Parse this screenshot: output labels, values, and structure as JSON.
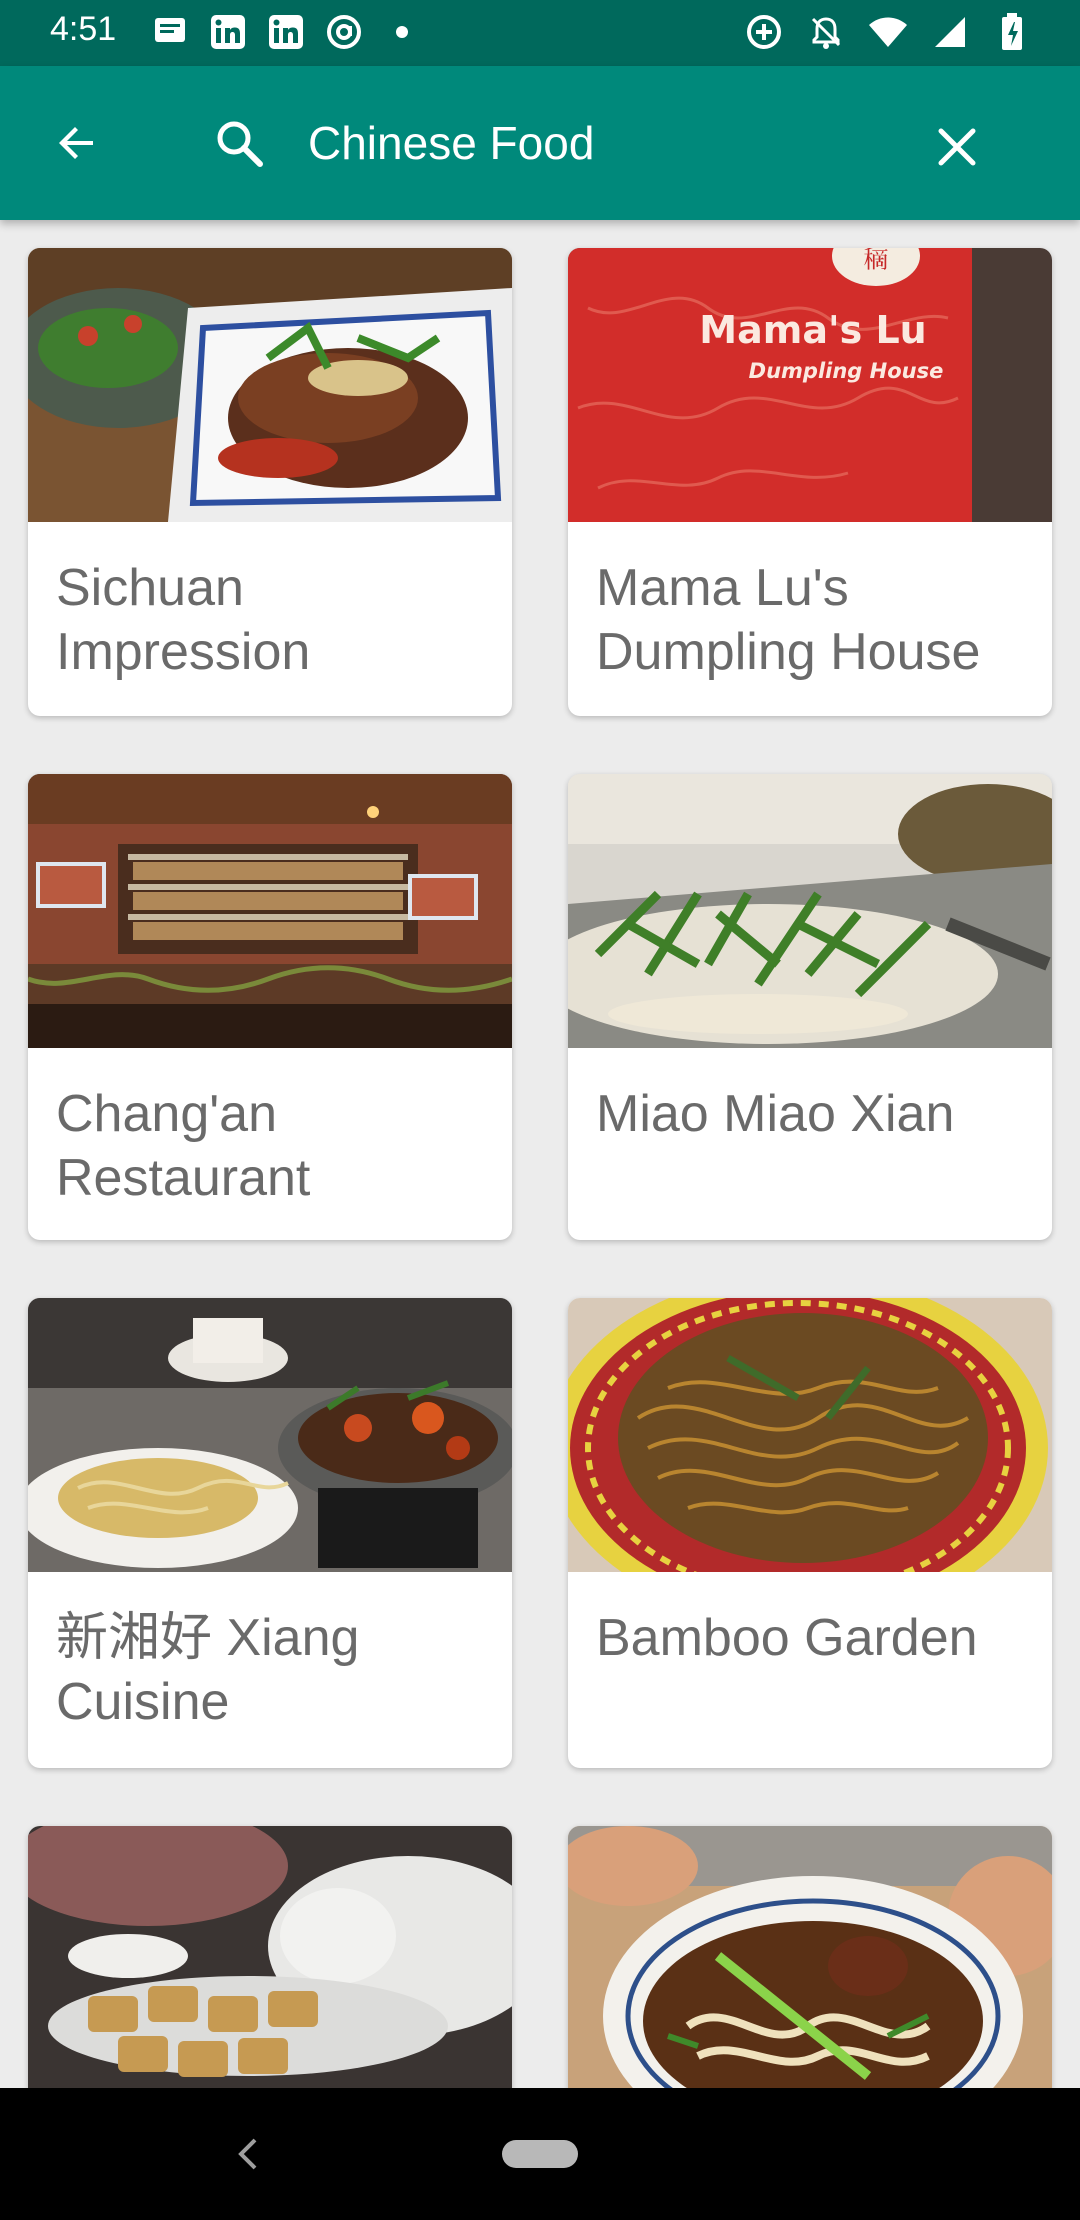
{
  "status_bar": {
    "time": "4:51",
    "left_icons": [
      "messages-icon",
      "linkedin-icon",
      "linkedin-icon",
      "at-sign-icon",
      "dot-icon"
    ],
    "right_icons": [
      "data-saver-icon",
      "notifications-off-icon",
      "wifi-icon",
      "signal-icon",
      "battery-icon"
    ]
  },
  "app_bar": {
    "search_value": "Chinese Food",
    "colors": {
      "status": "#00695c",
      "toolbar": "#00897b"
    }
  },
  "results": [
    {
      "title": "Sichuan Impression",
      "image": "sliced-beef-dish-photo"
    },
    {
      "title": "Mama Lu's Dumpling House",
      "image": "red-menu-cover-photo",
      "image_text": {
        "line1": "Mama's Lu",
        "line2": "Dumpling House"
      }
    },
    {
      "title": "Chang'an Restaurant",
      "image": "restaurant-bar-interior-photo"
    },
    {
      "title": "Miao Miao Xian",
      "image": "noodle-salad-photo"
    },
    {
      "title": "新湘好 Xiang Cuisine",
      "image": "noodles-and-chicken-photo"
    },
    {
      "title": "Bamboo Garden",
      "image": "chow-mein-plate-photo"
    },
    {
      "title": "",
      "image": "tofu-and-tea-photo"
    },
    {
      "title": "",
      "image": "beef-noodle-soup-photo"
    }
  ]
}
